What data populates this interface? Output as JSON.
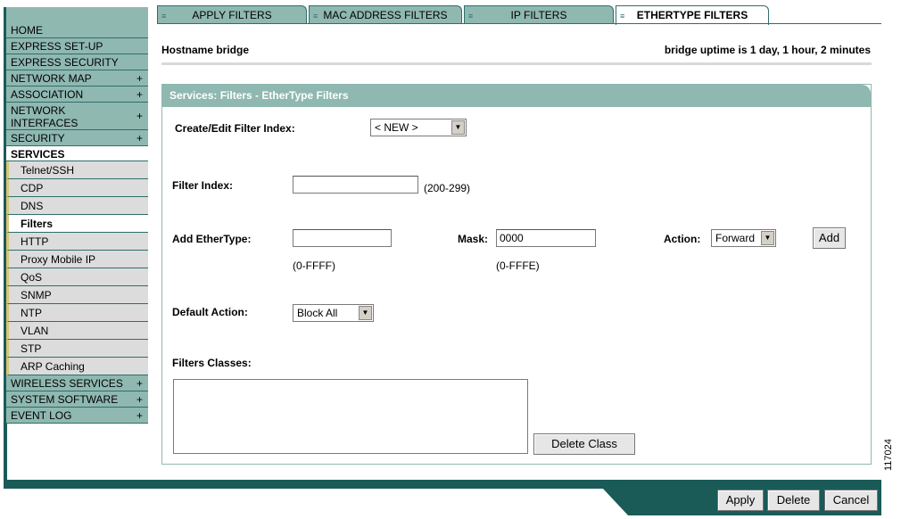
{
  "tabs": [
    {
      "label": "APPLY FILTERS",
      "active": false
    },
    {
      "label": "MAC ADDRESS FILTERS",
      "active": false
    },
    {
      "label": "IP FILTERS",
      "active": false
    },
    {
      "label": "ETHERTYPE FILTERS",
      "active": true
    }
  ],
  "sidebar": {
    "items_top": [
      {
        "label": "HOME",
        "plus": ""
      },
      {
        "label": "EXPRESS SET-UP",
        "plus": ""
      },
      {
        "label": "EXPRESS SECURITY",
        "plus": ""
      },
      {
        "label": "NETWORK MAP",
        "plus": "+"
      },
      {
        "label": "ASSOCIATION",
        "plus": "+"
      },
      {
        "label": "NETWORK INTERFACES",
        "plus": "+"
      },
      {
        "label": "SECURITY",
        "plus": "+"
      }
    ],
    "active_section": "SERVICES",
    "sub_items": [
      {
        "label": "Telnet/SSH"
      },
      {
        "label": "CDP"
      },
      {
        "label": "DNS"
      },
      {
        "label": "Filters",
        "active": true
      },
      {
        "label": "HTTP"
      },
      {
        "label": "Proxy Mobile IP"
      },
      {
        "label": "QoS"
      },
      {
        "label": "SNMP"
      },
      {
        "label": "NTP"
      },
      {
        "label": "VLAN"
      },
      {
        "label": "STP"
      },
      {
        "label": "ARP Caching"
      }
    ],
    "items_bottom": [
      {
        "label": "WIRELESS SERVICES",
        "plus": "+"
      },
      {
        "label": "SYSTEM SOFTWARE",
        "plus": "+"
      },
      {
        "label": "EVENT LOG",
        "plus": "+"
      }
    ]
  },
  "header": {
    "hostname": "Hostname  bridge",
    "uptime": "bridge uptime is 1 day, 1 hour, 2 minutes"
  },
  "panel": {
    "title": "Services: Filters - EtherType Filters",
    "create_edit_label": "Create/Edit Filter Index:",
    "create_edit_value": "< NEW >",
    "filter_index_label": "Filter Index:",
    "filter_index_value": "",
    "filter_index_hint": "(200-299)",
    "add_ethertype_label": "Add EtherType:",
    "add_ethertype_value": "",
    "ethertype_hint": "(0-FFFF)",
    "mask_label": "Mask:",
    "mask_value": "0000",
    "mask_hint": "(0-FFFE)",
    "action_label": "Action:",
    "action_value": "Forward",
    "add_button": "Add",
    "default_action_label": "Default Action:",
    "default_action_value": "Block All",
    "filters_classes_label": "Filters Classes:",
    "delete_class_button": "Delete Class"
  },
  "footer": {
    "apply": "Apply",
    "delete": "Delete",
    "cancel": "Cancel"
  },
  "figure_id": "117024",
  "colors": {
    "teal_light": "#8fb8b1",
    "teal_dark": "#1a5b58"
  }
}
